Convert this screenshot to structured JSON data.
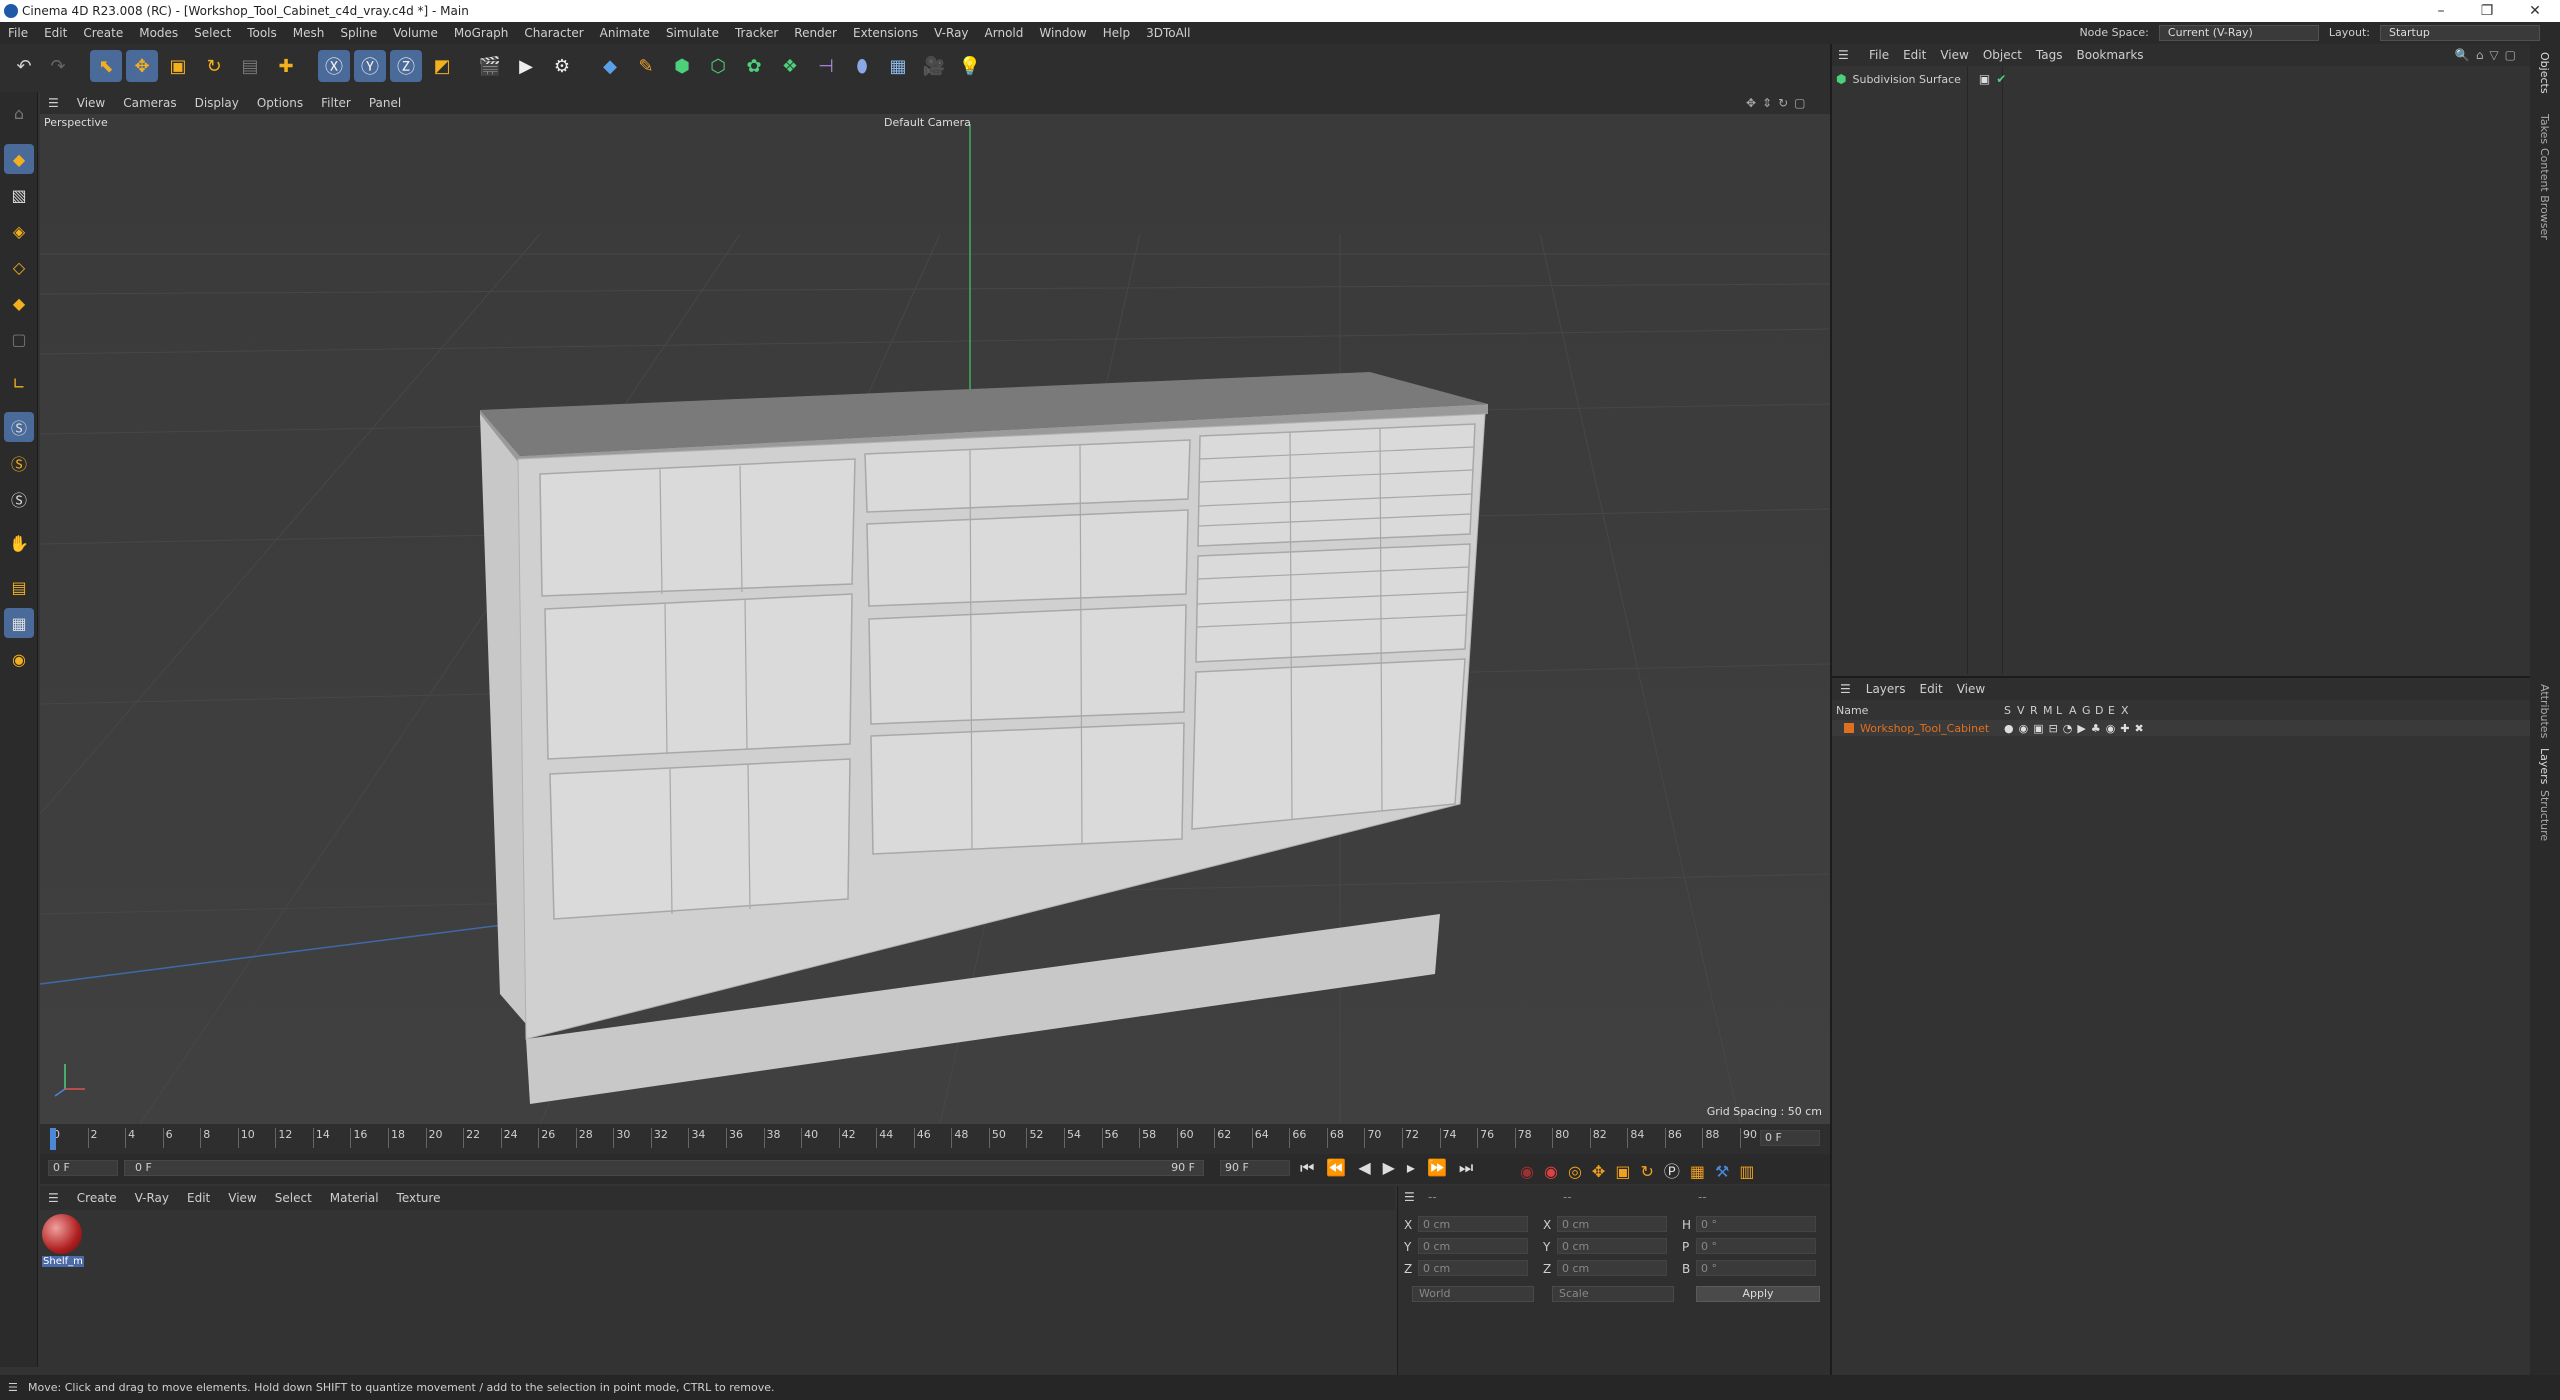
{
  "window": {
    "title": "Cinema 4D R23.008 (RC) - [Workshop_Tool_Cabinet_c4d_vray.c4d *] - Main",
    "minimize": "–",
    "maximize": "❐",
    "close": "✕"
  },
  "menubar": {
    "items": [
      "File",
      "Edit",
      "Create",
      "Modes",
      "Select",
      "Tools",
      "Mesh",
      "Spline",
      "Volume",
      "MoGraph",
      "Character",
      "Animate",
      "Simulate",
      "Tracker",
      "Render",
      "Extensions",
      "V-Ray",
      "Arnold",
      "Window",
      "Help",
      "3DToAll"
    ],
    "node_space_label": "Node Space:",
    "node_space_value": "Current (V-Ray)",
    "layout_label": "Layout:",
    "layout_value": "Startup"
  },
  "viewport": {
    "menu": [
      "View",
      "Cameras",
      "Display",
      "Options",
      "Filter",
      "Panel"
    ],
    "label": "Perspective",
    "camera": "Default Camera",
    "grid_spacing": "Grid Spacing : 50 cm"
  },
  "timeline": {
    "ticks": [
      "0",
      "2",
      "4",
      "6",
      "8",
      "10",
      "12",
      "14",
      "16",
      "18",
      "20",
      "22",
      "24",
      "26",
      "28",
      "30",
      "32",
      "34",
      "36",
      "38",
      "40",
      "42",
      "44",
      "46",
      "48",
      "50",
      "52",
      "54",
      "56",
      "58",
      "60",
      "62",
      "64",
      "66",
      "68",
      "70",
      "72",
      "74",
      "76",
      "78",
      "80",
      "82",
      "84",
      "86",
      "88",
      "90"
    ],
    "current_frame": "0 F",
    "start": "0 F",
    "range_start": "0 F",
    "range_end": "90 F",
    "end": "90 F"
  },
  "material_manager": {
    "menu": [
      "Create",
      "V-Ray",
      "Edit",
      "View",
      "Select",
      "Material",
      "Texture"
    ],
    "materials": [
      {
        "name": "Shelf_m"
      }
    ]
  },
  "coordinates": {
    "header": [
      "--",
      "--",
      "--"
    ],
    "rows": [
      {
        "a": "X",
        "av": "0 cm",
        "b": "X",
        "bv": "0 cm",
        "c": "H",
        "cv": "0 °"
      },
      {
        "a": "Y",
        "av": "0 cm",
        "b": "Y",
        "bv": "0 cm",
        "c": "P",
        "cv": "0 °"
      },
      {
        "a": "Z",
        "av": "0 cm",
        "b": "Z",
        "bv": "0 cm",
        "c": "B",
        "cv": "0 °"
      }
    ],
    "space": "World",
    "mode": "Scale",
    "apply": "Apply"
  },
  "objects": {
    "menu": [
      "File",
      "Edit",
      "View",
      "Object",
      "Tags",
      "Bookmarks"
    ],
    "items": [
      {
        "name": "Subdivision Surface"
      }
    ]
  },
  "layers": {
    "menu": [
      "Layers",
      "Edit",
      "View"
    ],
    "name_header": "Name",
    "flags": [
      "S",
      "V",
      "R",
      "M",
      "L",
      "A",
      "G",
      "D",
      "E",
      "X"
    ],
    "items": [
      {
        "name": "Workshop_Tool_Cabinet",
        "color": "#e07020"
      }
    ]
  },
  "side_tabs": [
    "Objects",
    "Takes",
    "Content Browser",
    "Attributes",
    "Layers",
    "Structure"
  ],
  "status": "Move: Click and drag to move elements. Hold down SHIFT to quantize movement / add to the selection in point mode, CTRL to remove.",
  "colors": {
    "accent": "#4a88d8",
    "orange": "#e07020",
    "bg": "#333333"
  }
}
